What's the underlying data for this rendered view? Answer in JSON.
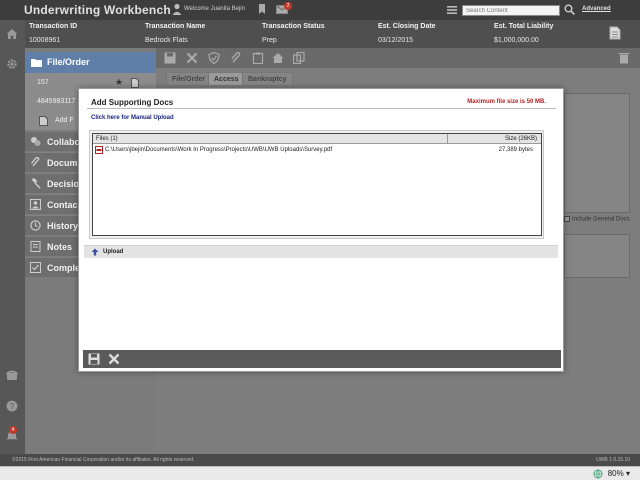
{
  "app": {
    "title": "Underwriting Workbench",
    "welcome": "Welcome Juanita Bejin",
    "mail_count": "2",
    "search_placeholder": "Search Content",
    "advanced": "Advanced",
    "notification_count": "4"
  },
  "transaction": {
    "columns": [
      {
        "header": "Transaction ID",
        "value": "10008961"
      },
      {
        "header": "Transaction Name",
        "value": "Bedrock Flats"
      },
      {
        "header": "Transaction Status",
        "value": "Prep"
      },
      {
        "header": "Est. Closing Date",
        "value": "03/12/2015"
      },
      {
        "header": "Est. Total Liability",
        "value": "$1,000,000.00"
      }
    ]
  },
  "nav": {
    "file_order": "File/Order",
    "sub1": "157",
    "sub2": "4845983117",
    "add": "Add F",
    "items": [
      "Collabo",
      "Docum",
      "Decisio",
      "Contac",
      "History",
      "Notes",
      "Comple"
    ]
  },
  "main": {
    "tabs": [
      "File/Order",
      "Access",
      "Bankruptcy"
    ],
    "include_general": "Include General Docs"
  },
  "modal": {
    "title": "Add Supporting Docs",
    "max_size": "Maximum file size is 50 MB.",
    "manual_upload": "Click here for Manual Upload",
    "files_header": "Files (1)",
    "size_header": "Size (26KB)",
    "files": [
      {
        "path": "C:\\Users\\jbejin\\Documents\\Work In Progress\\Projects\\UWB\\UWB Uploads\\Survey.pdf",
        "size": "27,389 bytes"
      }
    ],
    "upload": "Upload"
  },
  "footer": {
    "copyright": "©2015 First American Financial Corporation and/or its affiliates. All rights reserved.",
    "version": "UWB 1.0.15.10"
  },
  "status": {
    "zoom": "80%"
  },
  "colors": {
    "accent": "#5f7fa8",
    "warning": "#b22222",
    "link": "#1a237e",
    "badge": "#c0392b"
  }
}
